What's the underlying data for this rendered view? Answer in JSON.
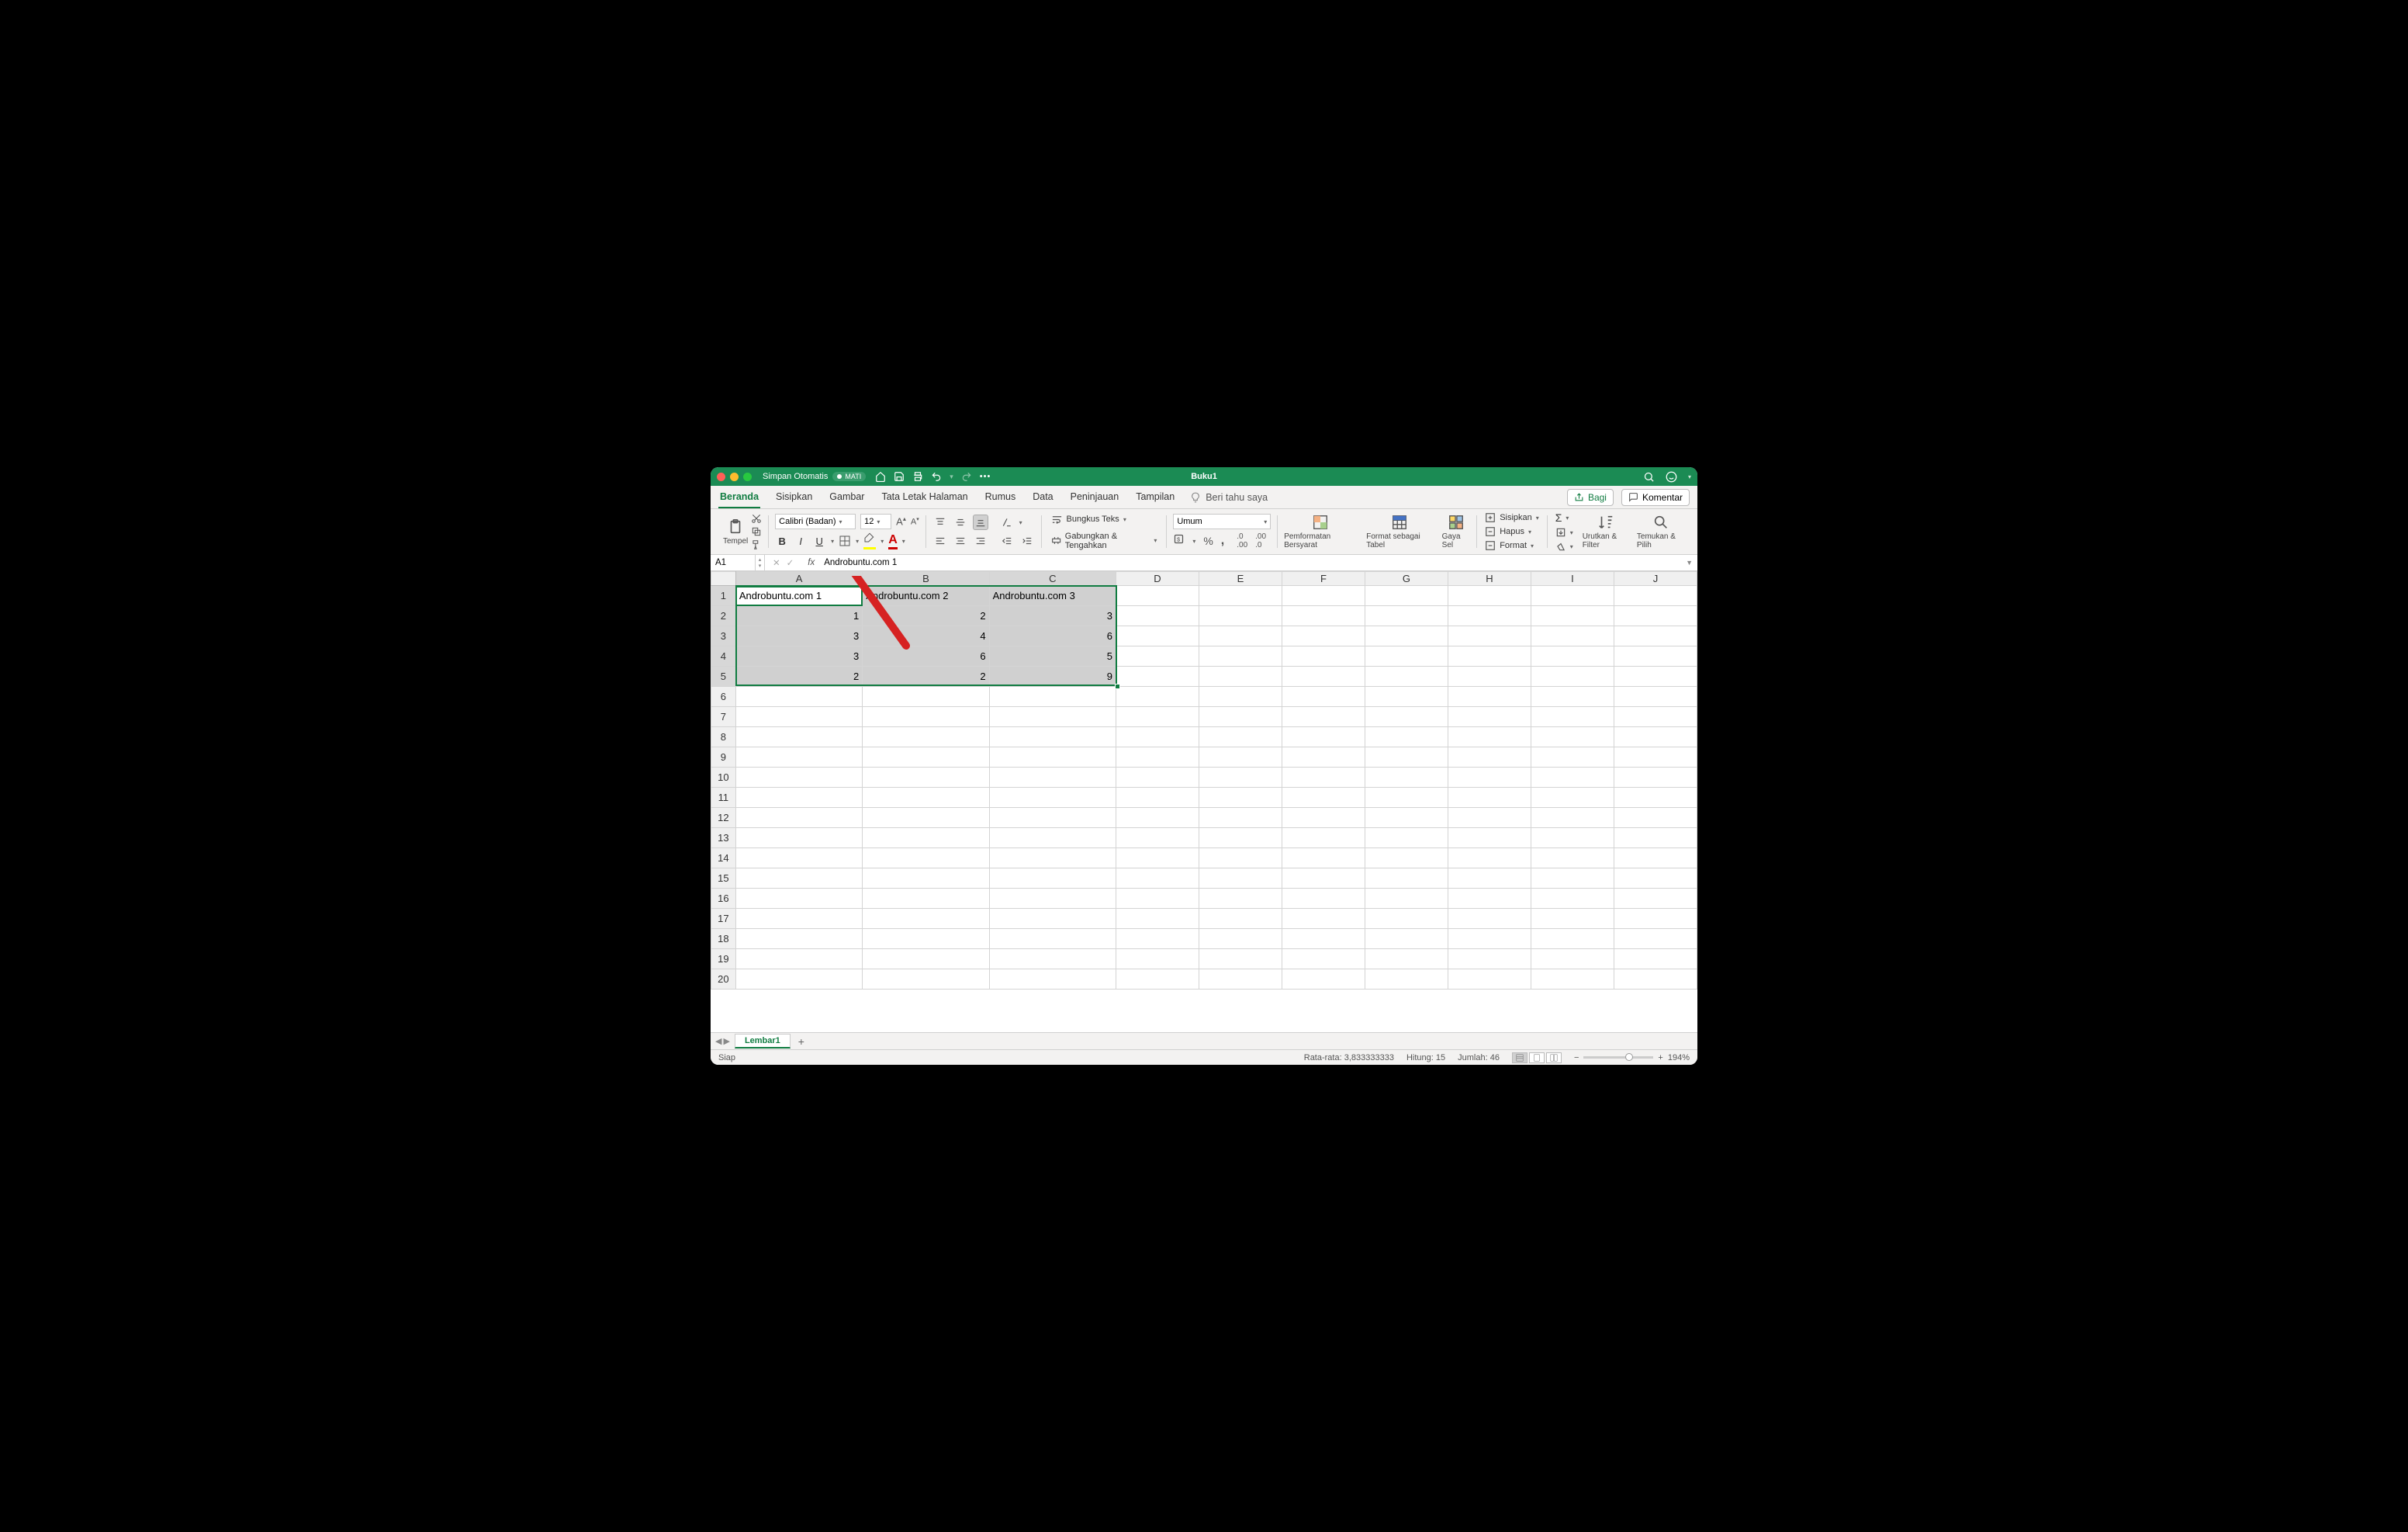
{
  "titlebar": {
    "autosave_label": "Simpan Otomatis",
    "autosave_state": "MATI",
    "doc_title": "Buku1"
  },
  "tabs": {
    "items": [
      "Beranda",
      "Sisipkan",
      "Gambar",
      "Tata Letak Halaman",
      "Rumus",
      "Data",
      "Peninjauan",
      "Tampilan"
    ],
    "active_index": 0,
    "tellme": "Beri tahu saya",
    "share": "Bagi",
    "comments": "Komentar"
  },
  "ribbon": {
    "paste": "Tempel",
    "font_name": "Calibri (Badan)",
    "font_size": "12",
    "wrap": "Bungkus Teks",
    "merge": "Gabungkan & Tengahkan",
    "numfmt": "Umum",
    "cond": "Pemformatan Bersyarat",
    "astable": "Format sebagai Tabel",
    "cellstyle": "Gaya Sel",
    "insert": "Sisipkan",
    "delete": "Hapus",
    "format": "Format",
    "sort": "Urutkan & Filter",
    "find": "Temukan & Pilih"
  },
  "formula_bar": {
    "cell_ref": "A1",
    "value": "Androbuntu.com 1"
  },
  "grid": {
    "columns": [
      "A",
      "B",
      "C",
      "D",
      "E",
      "F",
      "G",
      "H",
      "I",
      "J"
    ],
    "col_widths": [
      "wide",
      "wide",
      "wide",
      "normw",
      "normw",
      "normw",
      "normw",
      "normw",
      "normw",
      "normw"
    ],
    "row_count": 20,
    "selection": {
      "r1": 1,
      "c1": 1,
      "r2": 5,
      "c2": 3,
      "active_r": 1,
      "active_c": 1
    },
    "cells": {
      "1": {
        "1": "Androbuntu.com 1",
        "2": "Androbuntu.com 2",
        "3": "Androbuntu.com 3"
      },
      "2": {
        "1": "1",
        "2": "2",
        "3": "3"
      },
      "3": {
        "1": "3",
        "2": "4",
        "3": "6"
      },
      "4": {
        "1": "3",
        "2": "6",
        "3": "5"
      },
      "5": {
        "1": "2",
        "2": "2",
        "3": "9"
      }
    },
    "align": {
      "1": "left"
    }
  },
  "sheets": {
    "active": "Lembar1"
  },
  "status": {
    "ready": "Siap",
    "avg_label": "Rata-rata:",
    "avg_val": "3,833333333",
    "count_label": "Hitung:",
    "count_val": "15",
    "sum_label": "Jumlah:",
    "sum_val": "46",
    "zoom": "194%"
  }
}
